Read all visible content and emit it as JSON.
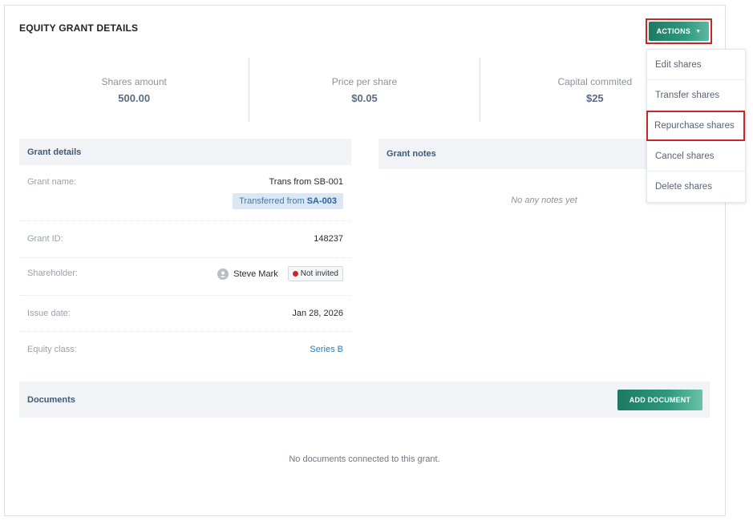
{
  "page": {
    "title": "EQUITY GRANT DETAILS"
  },
  "actions": {
    "label": "ACTIONS",
    "menu": [
      "Edit shares",
      "Transfer shares",
      "Repurchase shares",
      "Cancel shares",
      "Delete shares"
    ]
  },
  "stats": [
    {
      "label": "Shares amount",
      "value": "500.00"
    },
    {
      "label": "Price per share",
      "value": "$0.05"
    },
    {
      "label": "Capital commited",
      "value": "$25"
    }
  ],
  "grant_details": {
    "title": "Grant details",
    "name_label": "Grant name:",
    "name_value": "Trans from SB-001",
    "transfer_prefix": "Transferred from",
    "transfer_ref": "SA-003",
    "id_label": "Grant ID:",
    "id_value": "148237",
    "holder_label": "Shareholder:",
    "holder_name": "Steve Mark",
    "holder_status": "Not invited",
    "issue_label": "Issue date:",
    "issue_value": "Jan 28, 2026",
    "class_label": "Equity class:",
    "class_value": "Series B"
  },
  "grant_notes": {
    "title": "Grant notes",
    "empty": "No any notes yet"
  },
  "documents": {
    "title": "Documents",
    "add_label": "ADD DOCUMENT",
    "empty": "No documents connected to this grant."
  },
  "colors": {
    "accent": "#2d9a7c",
    "highlight": "#c62828",
    "status_dot": "#c62828"
  }
}
